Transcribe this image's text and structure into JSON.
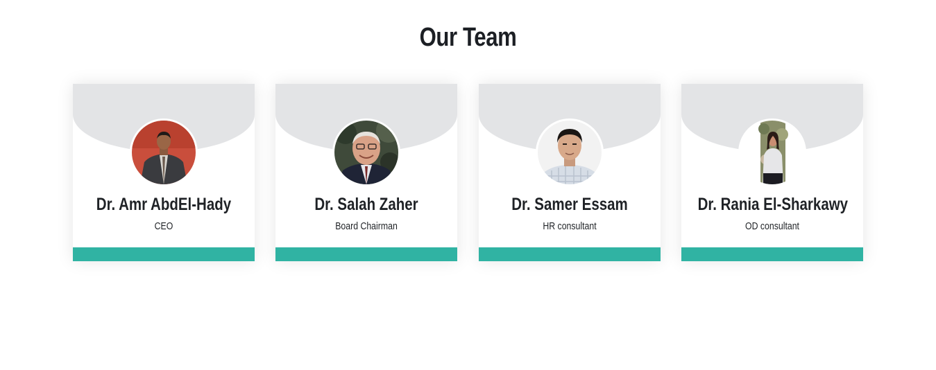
{
  "section": {
    "title": "Our Team"
  },
  "theme": {
    "accent": "#30b3a3",
    "card_header": "#e3e4e6"
  },
  "team": [
    {
      "name": "Dr. Amr AbdEl-Hady",
      "role": "CEO",
      "photo": "portrait-man-red-background"
    },
    {
      "name": "Dr. Salah Zaher",
      "role": "Board Chairman",
      "photo": "portrait-older-man-smiling"
    },
    {
      "name": "Dr. Samer Essam",
      "role": "HR consultant",
      "photo": "portrait-young-man-white-background"
    },
    {
      "name": "Dr. Rania El-Sharkawy",
      "role": "OD consultant",
      "photo": "portrait-woman-standing"
    }
  ]
}
